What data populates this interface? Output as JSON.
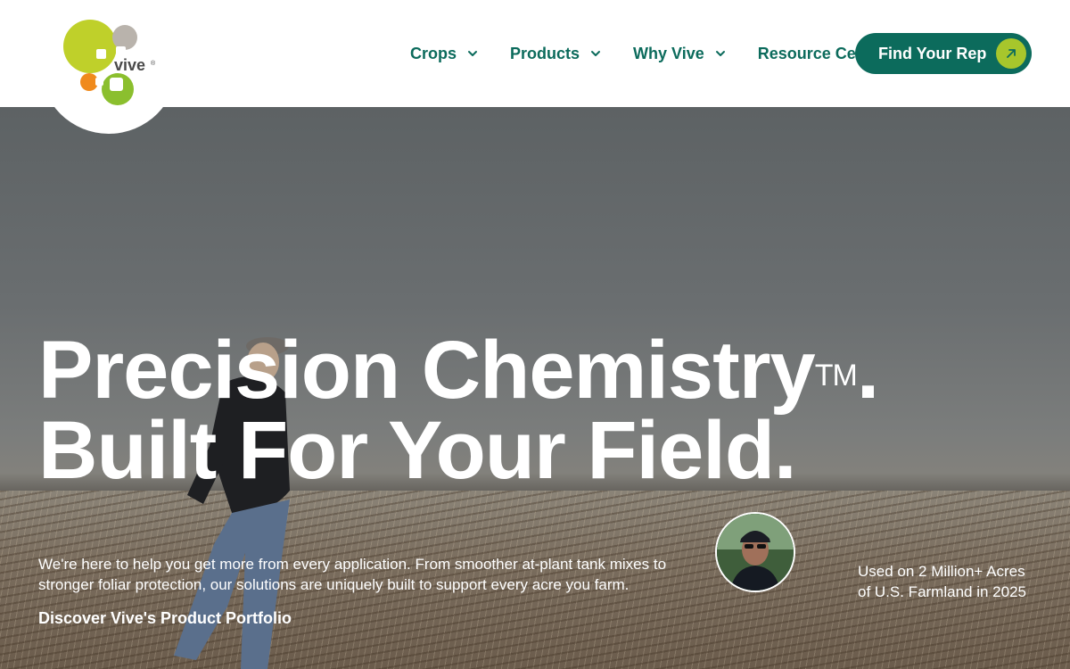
{
  "brand": {
    "name": "vive",
    "accent": "#0c6b5c",
    "lime": "#a7c62c",
    "orange": "#f08a1c"
  },
  "nav": {
    "items": [
      {
        "label": "Crops",
        "has_dropdown": true
      },
      {
        "label": "Products",
        "has_dropdown": true
      },
      {
        "label": "Why Vive",
        "has_dropdown": true
      },
      {
        "label": "Resource Center",
        "has_dropdown": false
      }
    ],
    "cta_label": "Find Your Rep",
    "cta_icon": "arrow-up-right-icon"
  },
  "hero": {
    "title_line1": "Precision Chemistry",
    "title_tm": "TM",
    "title_period": ".",
    "title_line2": "Built For Your Field.",
    "description": "We're here to help you get more from every application. From smoother at-plant tank mixes to stronger foliar protection, our solutions are uniquely built to support every acre you farm.",
    "link_label": "Discover Vive's Product Portfolio",
    "stat_text": "Used on 2 Million+ Acres of U.S. Farmland in 2025"
  }
}
